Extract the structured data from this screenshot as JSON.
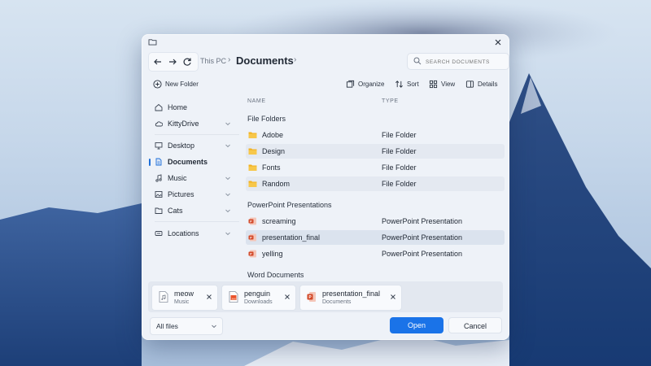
{
  "titlebar": {
    "close_icon": "close-icon",
    "folder_icon": "folder-icon"
  },
  "nav": {
    "back_icon": "arrow-left-icon",
    "forward_icon": "arrow-right-icon",
    "refresh_icon": "refresh-icon",
    "breadcrumb_root": "This PC",
    "breadcrumb_current": "Documents",
    "search_placeholder": "SEARCH DOCUMENTS"
  },
  "toolbar": {
    "new_folder": "New Folder",
    "organize": "Organize",
    "sort": "Sort",
    "view": "View",
    "details": "Details"
  },
  "sidebar": {
    "items": [
      {
        "label": "Home",
        "icon": "home-icon"
      },
      {
        "label": "KittyDrive",
        "icon": "cloud-icon"
      },
      {
        "label": "Desktop",
        "icon": "desktop-icon"
      },
      {
        "label": "Documents",
        "icon": "document-icon"
      },
      {
        "label": "Music",
        "icon": "music-icon"
      },
      {
        "label": "Pictures",
        "icon": "picture-icon"
      },
      {
        "label": "Cats",
        "icon": "folder-icon"
      },
      {
        "label": "Locations",
        "icon": "location-icon"
      }
    ]
  },
  "list": {
    "columns": {
      "name": "NAME",
      "type": "TYPE"
    },
    "groups": {
      "folders": "File Folders",
      "ppt": "PowerPoint Presentations",
      "word": "Word Documents"
    },
    "folders": [
      {
        "name": "Adobe",
        "type": "File Folder"
      },
      {
        "name": "Design",
        "type": "File Folder"
      },
      {
        "name": "Fonts",
        "type": "File Folder"
      },
      {
        "name": "Random",
        "type": "File Folder"
      }
    ],
    "presentations": [
      {
        "name": "screaming",
        "type": "PowerPoint Presentation"
      },
      {
        "name": "presentation_final",
        "type": "PowerPoint Presentation"
      },
      {
        "name": "yelling",
        "type": "PowerPoint Presentation"
      }
    ]
  },
  "tray": {
    "chips": [
      {
        "name": "meow",
        "location": "Music"
      },
      {
        "name": "penguin",
        "location": "Downloads"
      },
      {
        "name": "presentation_final",
        "location": "Documents"
      }
    ]
  },
  "bottom": {
    "filter_value": "All files",
    "open_label": "Open",
    "cancel_label": "Cancel"
  },
  "colors": {
    "accent": "#1a73e8",
    "folder": "#f2b01e",
    "ppt": "#d24726"
  }
}
